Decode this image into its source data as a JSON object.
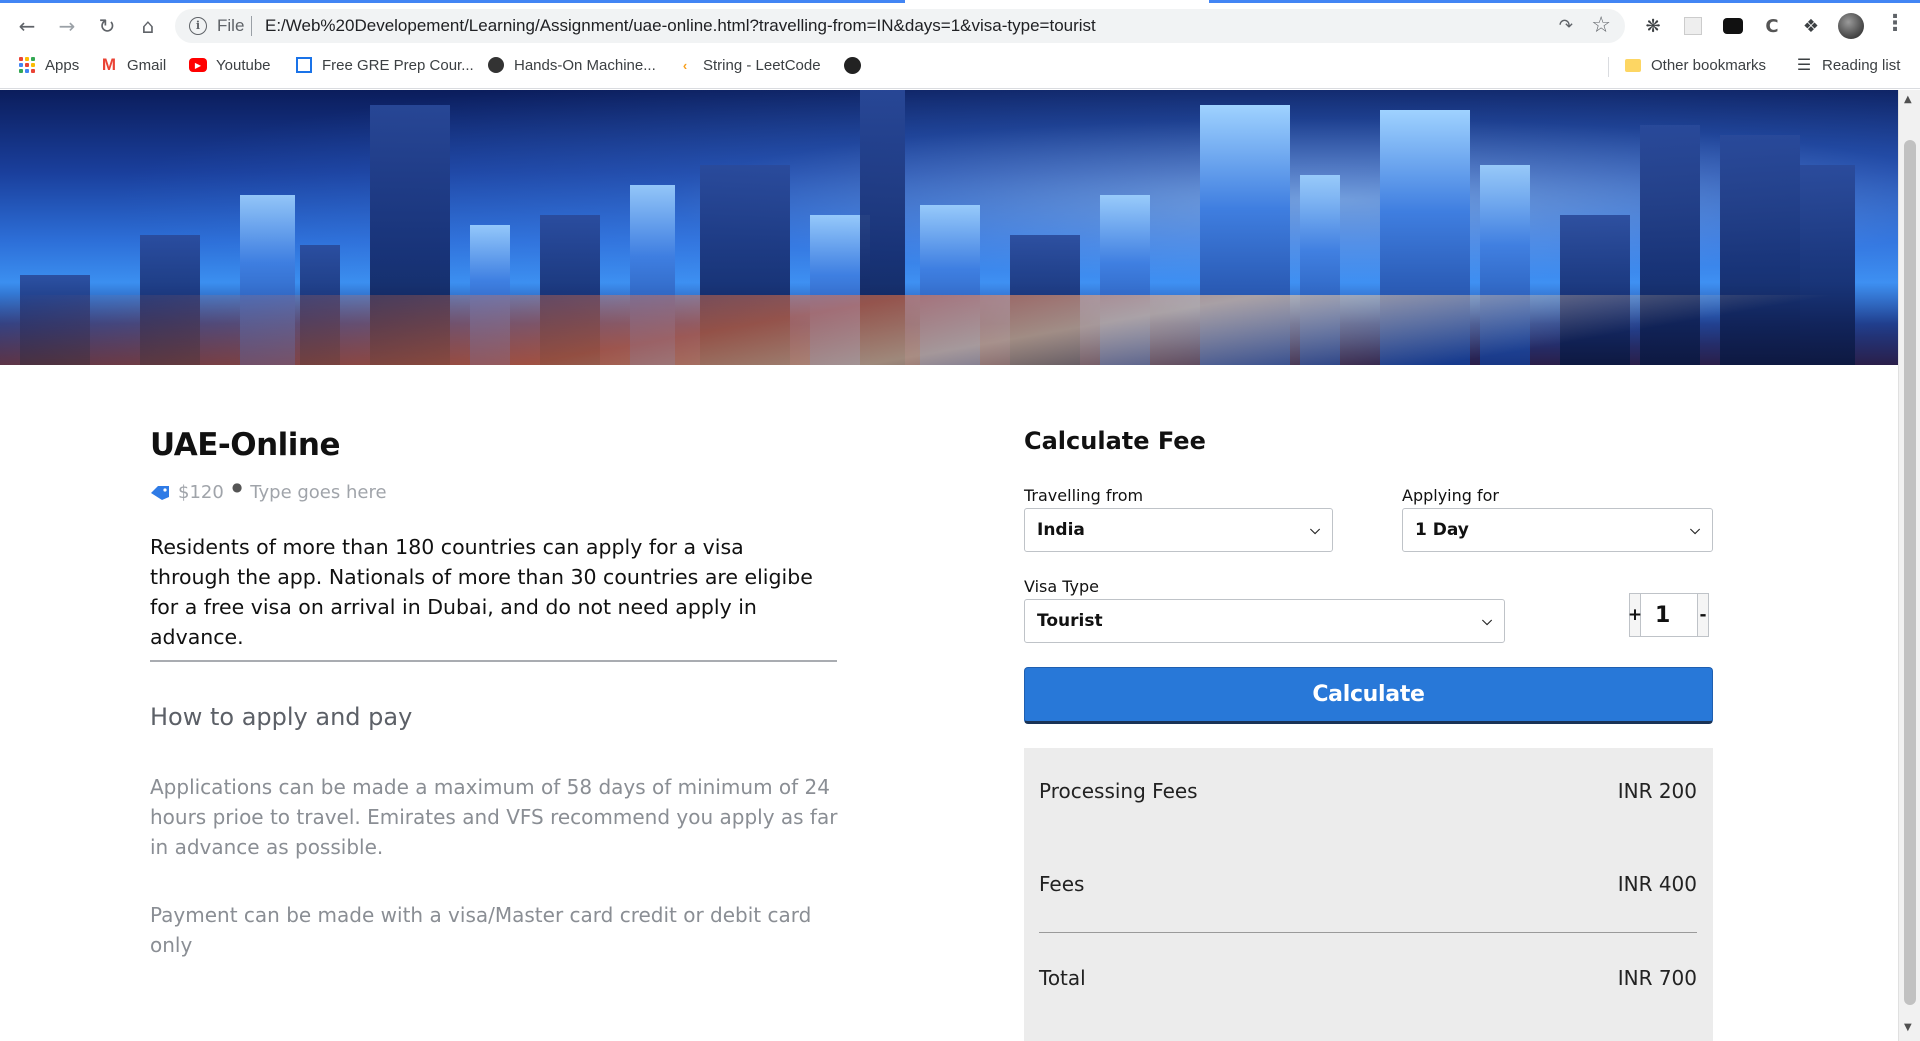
{
  "browser": {
    "address_file_label": "File",
    "url": "E:/Web%20Developement/Learning/Assignment/uae-online.html?travelling-from=IN&days=1&visa-type=tourist",
    "bookmarks": [
      {
        "label": "Apps",
        "icon": "apps-grid-icon"
      },
      {
        "label": "Gmail",
        "icon": "gmail-icon"
      },
      {
        "label": "Youtube",
        "icon": "youtube-icon"
      },
      {
        "label": "Free GRE Prep Cour...",
        "icon": "gre-icon"
      },
      {
        "label": "Hands-On Machine...",
        "icon": "book-icon"
      },
      {
        "label": "String - LeetCode",
        "icon": "leetcode-icon"
      },
      {
        "label": "",
        "icon": "globe-icon"
      }
    ],
    "other_bookmarks": "Other bookmarks",
    "reading_list": "Reading list"
  },
  "listing": {
    "title": "UAE-Online",
    "price": "$120",
    "type": "Type goes here",
    "intro": "Residents of more than 180 countries can apply for a visa through the app. Nationals of more than 30 countries are eligibe for a free visa on arrival in Dubai, and do not need apply in advance.",
    "howto_heading": "How to apply and pay",
    "howto_p1": "Applications can be made a maximum of 58 days of minimum of 24 hours prioe to travel. Emirates and VFS recommend you apply as far in advance as possible.",
    "howto_p2": "Payment can be made with a visa/Master card credit or debit card only"
  },
  "calculator": {
    "title": "Calculate Fee",
    "travelling_from_label": "Travelling from",
    "travelling_from_value": "India",
    "applying_for_label": "Applying for",
    "applying_for_value": "1 Day",
    "visa_type_label": "Visa Type",
    "visa_type_value": "Tourist",
    "stepper_plus": "+",
    "stepper_minus": "-",
    "stepper_value": "1",
    "button_label": "Calculate",
    "fees": [
      {
        "label": "Processing Fees",
        "value": "INR 200"
      },
      {
        "label": "Fees",
        "value": "INR 400"
      },
      {
        "label": "Total",
        "value": "INR 700"
      }
    ]
  },
  "colors": {
    "accent": "#2878d8",
    "fee_box": "#ececec",
    "muted_text": "#8a8e94"
  }
}
